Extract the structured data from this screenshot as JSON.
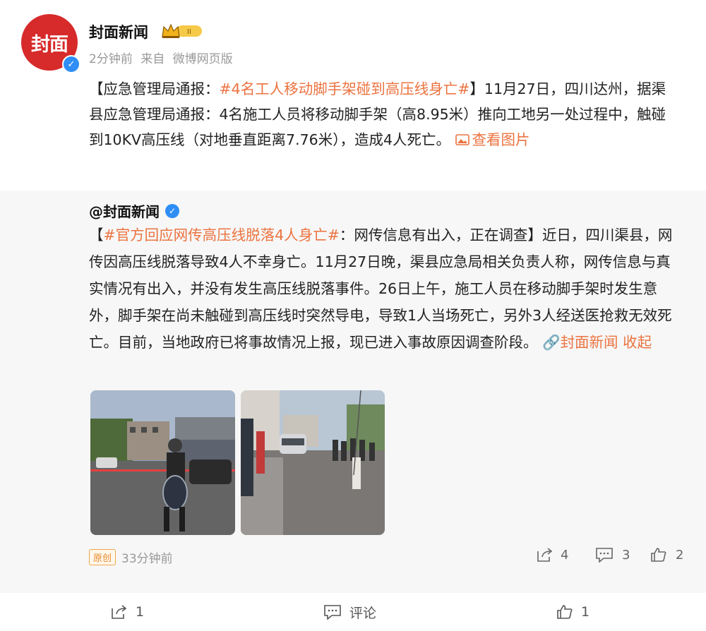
{
  "author": {
    "name": "封面新闻",
    "avatar_text": "封面",
    "level_badge": "II"
  },
  "meta": {
    "time": "2分钟前",
    "source_prefix": "来自",
    "source": "微博网页版"
  },
  "post": {
    "bracket_open": "【应急管理局通报：",
    "hashtag": "#4名工人移动脚手架碰到高压线身亡#",
    "body": "】11月27日，四川达州，据渠县应急管理局通报：4名施工人员将移动脚手架（高8.95米）推向工地另一处过程中，触碰到10KV高压线（对地垂直距离7.76米），造成4人死亡。",
    "view_images": "查看图片"
  },
  "retweet": {
    "author": "@封面新闻",
    "bracket_open": "【",
    "hashtag": "#官方回应网传高压线脱落4人身亡#",
    "body": "：网传信息有出入，正在调查】近日，四川渠县，网传因高压线脱落导致4人不幸身亡。11月27日晚，渠县应急局相关负责人称，网传信息与真实情况有出入，并没有发生高压线脱落事件。26日上午，施工人员在移动脚手架时发生意外，脚手架在尚未触碰到高压线时突然导电，导致1人当场死亡，另外3人经送医抢救无效死亡。目前，当地政府已将事故情况上报，现已进入事故原因调查阶段。",
    "link_label": "封面新闻",
    "collapse": "收起",
    "original_badge": "原创",
    "time": "33分钟前",
    "shares": "4",
    "comments": "3",
    "likes": "2"
  },
  "actions": {
    "share_count": "1",
    "comment_label": "评论",
    "like_count": "1"
  },
  "colors": {
    "accent": "#eb7340",
    "brand_red": "#d72a2a",
    "verify_blue": "#2f8ef5"
  }
}
